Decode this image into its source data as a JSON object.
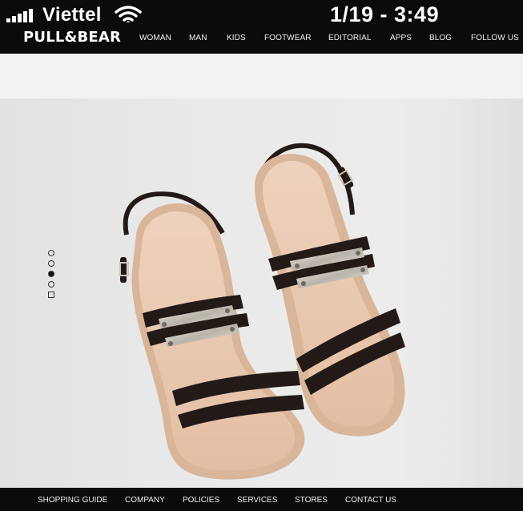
{
  "status_bar": {
    "carrier": "Viettel",
    "time": "1/19 - 3:49",
    "signal_icon": "signal-bars-icon",
    "wifi_icon": "wifi-icon"
  },
  "nav": {
    "logo": "PULL&BEAR",
    "items": [
      {
        "label": "WOMAN"
      },
      {
        "label": "MAN"
      },
      {
        "label": "KIDS"
      },
      {
        "label": "FOOTWEAR"
      },
      {
        "label": "EDITORIAL"
      },
      {
        "label": "APPS"
      },
      {
        "label": "BLOG"
      },
      {
        "label": "FOLLOW US"
      }
    ]
  },
  "carousel": {
    "slide_count": 5,
    "active_index": 2
  },
  "footer": {
    "links": [
      {
        "label": "SHOPPING GUIDE"
      },
      {
        "label": "COMPANY"
      },
      {
        "label": "POLICIES"
      },
      {
        "label": "SERVICES"
      },
      {
        "label": "STORES"
      },
      {
        "label": "CONTACT US"
      }
    ]
  },
  "colors": {
    "bar": "#0b0b0b",
    "sandal_strap": "#2a1f1c",
    "sandal_sole": "#e6c4ac",
    "metal_plate": "#c9c4ba"
  }
}
